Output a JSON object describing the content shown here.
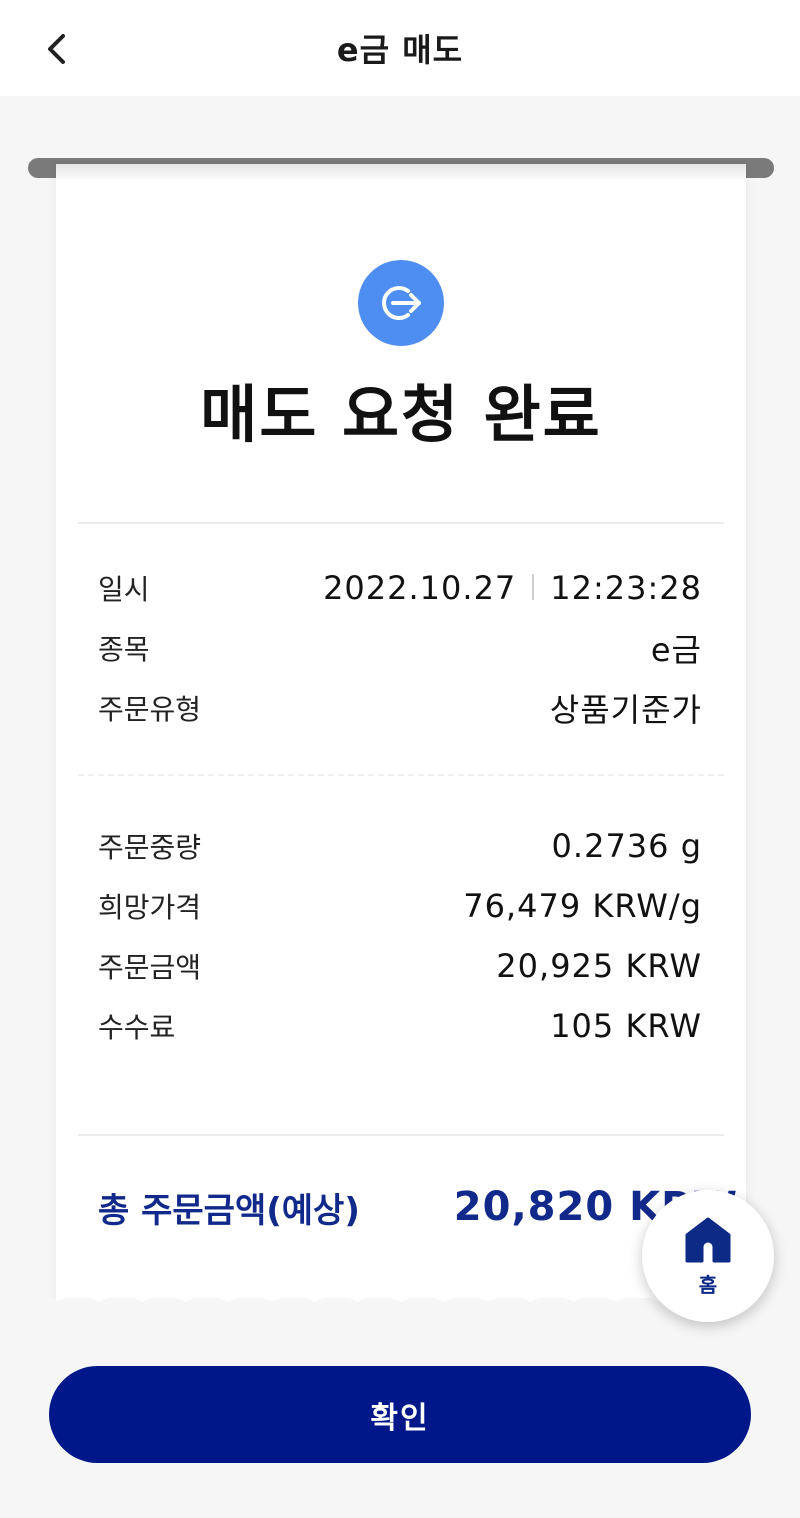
{
  "header": {
    "title": "e금 매도",
    "back_icon": "chevron-left-icon"
  },
  "receipt": {
    "status_icon": "sign-out-arrow-icon",
    "status_icon_color": "#4e8ef2",
    "title": "매도 요청 완료",
    "order_info": [
      {
        "label": "일시",
        "date": "2022.10.27",
        "time": "12:23:28"
      },
      {
        "label": "종목",
        "value": "e금"
      },
      {
        "label": "주문유형",
        "value": "상품기준가"
      }
    ],
    "amounts": [
      {
        "label": "주문중량",
        "value": "0.2736 g"
      },
      {
        "label": "희망가격",
        "value": "76,479 KRW/g"
      },
      {
        "label": "주문금액",
        "value": "20,925 KRW"
      },
      {
        "label": "수수료",
        "value": "105 KRW"
      }
    ],
    "total": {
      "label": "총 주문금액(예상)",
      "value": "20,820 KRW",
      "color": "#11298a"
    }
  },
  "home_button": {
    "label": "홈",
    "icon": "home-icon"
  },
  "confirm_button": {
    "label": "확인",
    "color": "#00178a"
  }
}
